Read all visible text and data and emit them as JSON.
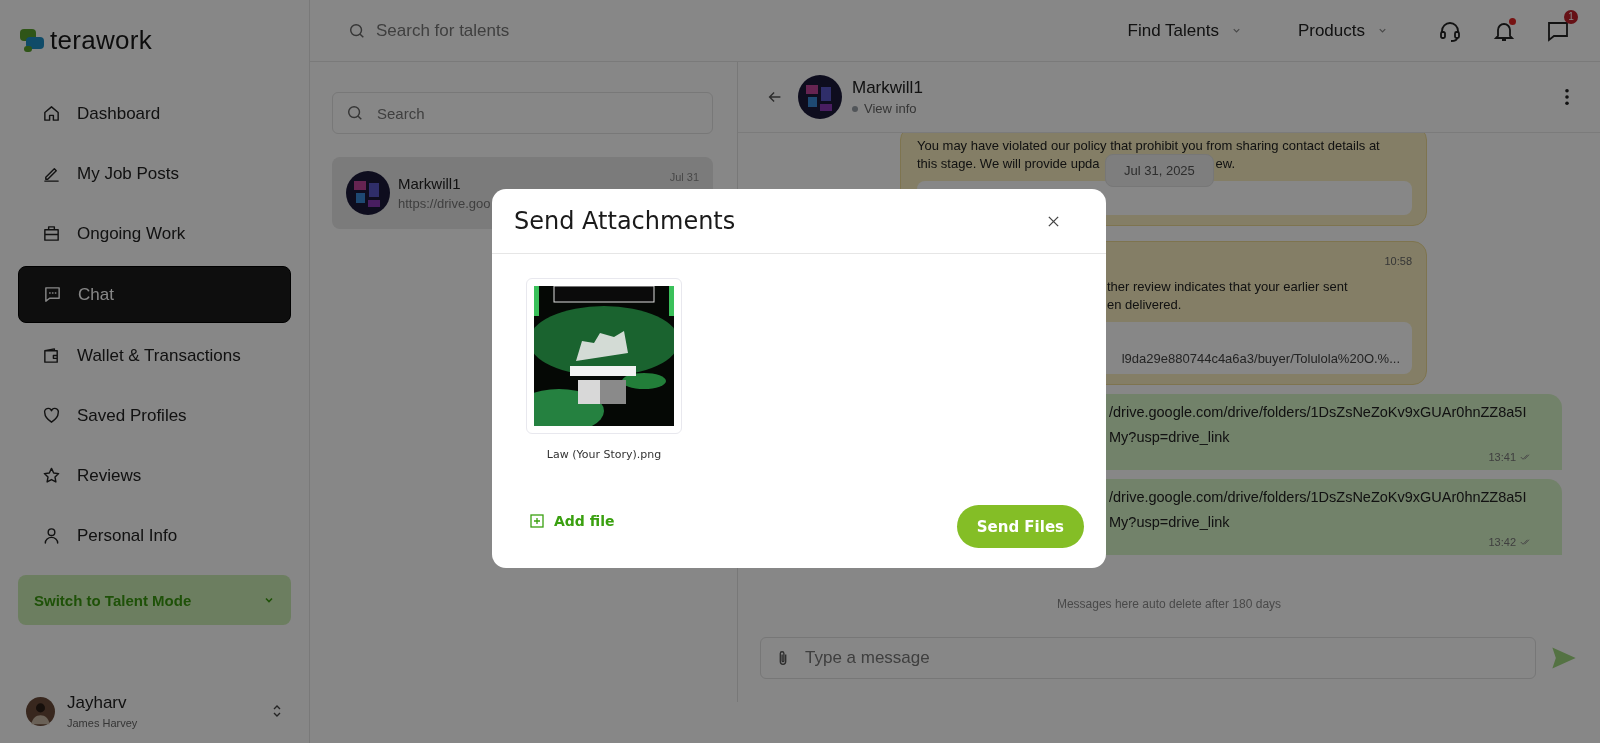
{
  "brand": {
    "name": "terawork"
  },
  "sidebar": {
    "items": [
      {
        "label": "Dashboard",
        "selected": false
      },
      {
        "label": "My Job Posts",
        "selected": false
      },
      {
        "label": "Ongoing Work",
        "selected": false
      },
      {
        "label": "Chat",
        "selected": true
      },
      {
        "label": "Wallet & Transactions",
        "selected": false
      },
      {
        "label": "Saved Profiles",
        "selected": false
      },
      {
        "label": "Reviews",
        "selected": false
      },
      {
        "label": "Personal Info",
        "selected": false
      }
    ],
    "mode_switch": {
      "label": "Switch to Talent Mode"
    },
    "user": {
      "name": "Jayharv",
      "full_name": "James Harvey"
    }
  },
  "topbar": {
    "search": {
      "placeholder": "Search for talents"
    },
    "menus": [
      "Find Talents",
      "Products"
    ],
    "notifications": {
      "unread": true
    },
    "messages": {
      "badge": "1"
    }
  },
  "chat_list": {
    "search": {
      "placeholder": "Search"
    },
    "conversations": [
      {
        "name": "Markwill1",
        "preview": "https://drive.goo",
        "date": "Jul 31",
        "selected": true
      }
    ]
  },
  "chat": {
    "contact": {
      "name": "Markwill1",
      "status": "View info"
    },
    "date_chip": "Jul 31, 2025",
    "messages": [
      {
        "kind": "system",
        "lines": [
          [
            "You may have violated our policy that prohibit you from sharing contact details at"
          ],
          [
            "this stage. We will provide upda",
            "ew."
          ]
        ],
        "has_preview": true
      },
      {
        "kind": "system",
        "time": "10:58",
        "lines": [
          [
            "ther review indicates that your earlier sent"
          ],
          [
            "en delivered."
          ]
        ],
        "preview": "l9da29e880744c4a6a3/buyer/Tolulola%20O.%..."
      },
      {
        "kind": "sent",
        "lines": [
          [
            "/drive.google.com/drive/folders/1DsZsNeZoKv9xGUAr0hnZZ8a5I"
          ],
          [
            "My?usp=drive_link"
          ]
        ],
        "time": "13:41",
        "delivered": true
      },
      {
        "kind": "sent",
        "lines": [
          [
            "/drive.google.com/drive/folders/1DsZsNeZoKv9xGUAr0hnZZ8a5I"
          ],
          [
            "My?usp=drive_link"
          ]
        ],
        "time": "13:42",
        "delivered": true
      }
    ],
    "retention_note": "Messages here auto delete after 180 days",
    "composer": {
      "placeholder": "Type a message"
    }
  },
  "modal": {
    "title": "Send Attachments",
    "files": [
      {
        "name": "Law (Your Story).png",
        "kind": "picture"
      }
    ],
    "add_label": "Add file",
    "send_label": "Send Files"
  }
}
